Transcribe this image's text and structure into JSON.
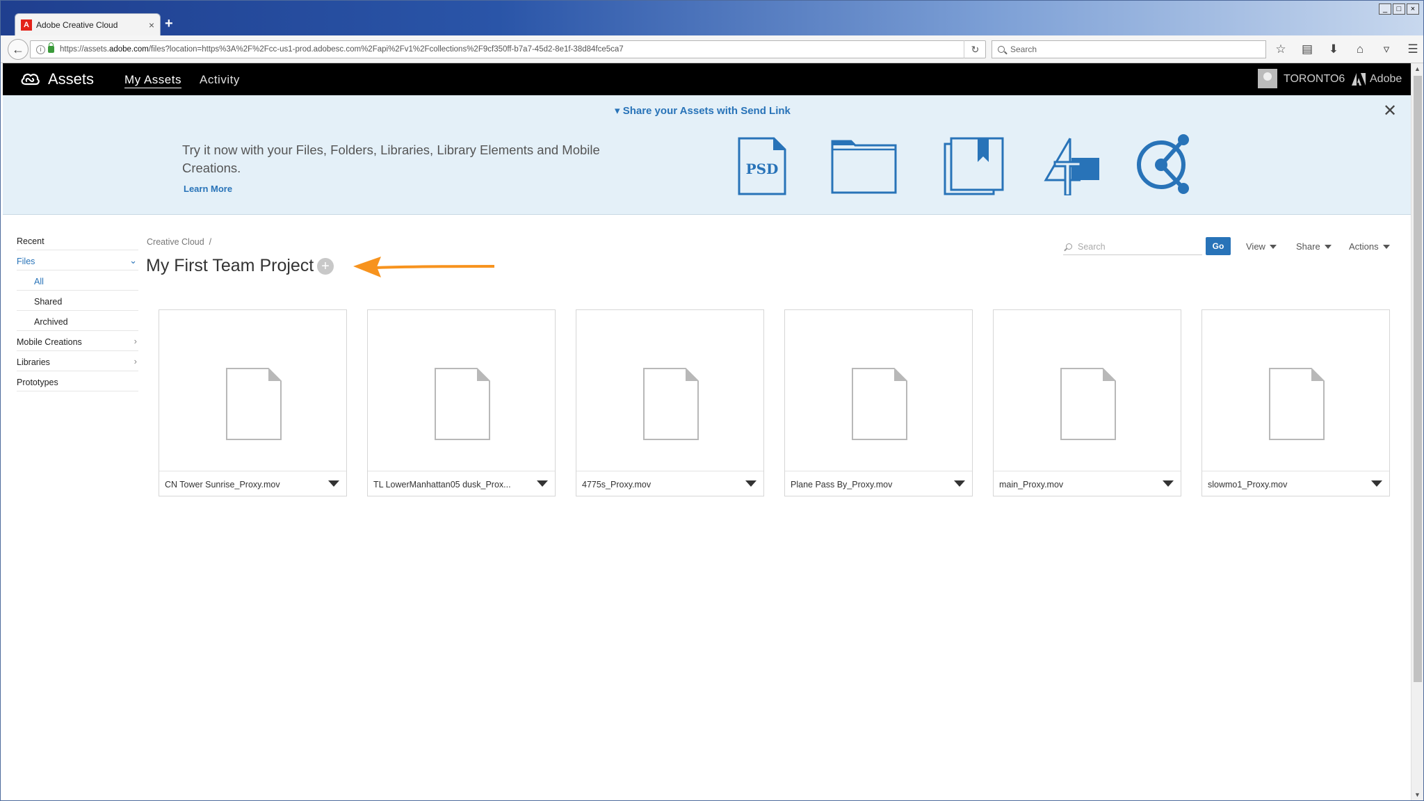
{
  "browser": {
    "tab_title": "Adobe Creative Cloud",
    "tab_close": "×",
    "new_tab": "+",
    "url_prefix": "https://assets.",
    "url_domain": "adobe.com",
    "url_rest": "/files?location=https%3A%2F%2Fcc-us1-prod.adobesc.com%2Fapi%2Fv1%2Fcollections%2F9cf350ff-b7a7-45d2-8e1f-38d84fce5ca7",
    "search_placeholder": "Search",
    "window_controls": [
      "_",
      "□",
      "×"
    ]
  },
  "header": {
    "app_title": "Assets",
    "nav": [
      "My Assets",
      "Activity"
    ],
    "user": "TORONTO6",
    "brand": "Adobe"
  },
  "banner": {
    "title": "Share your Assets with Send Link",
    "text": "Try it now with your Files, Folders, Libraries, Library Elements and Mobile Creations.",
    "learn_more": "Learn More",
    "psd_label": "PSD",
    "close": "✕"
  },
  "sidebar": {
    "items": [
      {
        "label": "Recent"
      },
      {
        "label": "Files"
      },
      {
        "label": "All"
      },
      {
        "label": "Shared"
      },
      {
        "label": "Archived"
      },
      {
        "label": "Mobile Creations"
      },
      {
        "label": "Libraries"
      },
      {
        "label": "Prototypes"
      }
    ]
  },
  "main": {
    "breadcrumb": "Creative Cloud  /",
    "title": "My First Team Project",
    "search_placeholder": "Search",
    "go": "Go",
    "view": "View",
    "share": "Share",
    "actions": "Actions",
    "files": [
      "CN Tower Sunrise_Proxy.mov",
      "TL LowerManhattan05 dusk_Prox...",
      "4775s_Proxy.mov",
      "Plane Pass By_Proxy.mov",
      "main_Proxy.mov",
      "slowmo1_Proxy.mov"
    ]
  },
  "colors": {
    "accent_blue": "#2873b8",
    "arrow_orange": "#f7931e",
    "banner_bg": "#e4f0f8",
    "header_bg": "#000000"
  }
}
